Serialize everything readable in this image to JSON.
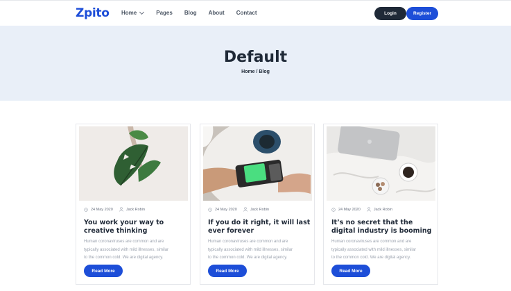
{
  "brand": {
    "logo": "Zpito",
    "accent": "#1d4ed8"
  },
  "nav": {
    "items": [
      {
        "label": "Home",
        "has_dropdown": true
      },
      {
        "label": "Pages"
      },
      {
        "label": "Blog"
      },
      {
        "label": "About"
      },
      {
        "label": "Contact"
      }
    ],
    "login": "Login",
    "register": "Register"
  },
  "hero": {
    "title": "Default",
    "breadcrumb": "Home / Blog"
  },
  "posts": [
    {
      "date": "24 May 2020",
      "author": "Jack Robin",
      "title": "You work your way to creative thinking",
      "excerpt": "Human coronaviruses are common and are typically associated with mild illnesses, similar to the common cold. We are digital agency.",
      "button": "Read More",
      "image": "hand-holding-plant-photo"
    },
    {
      "date": "24 May 2020",
      "author": "Jack Robin",
      "title": "If you do it right, it will last ever forever",
      "excerpt": "Human coronaviruses are common and are typically associated with mild illnesses, similar to the common cold. We are digital agency.",
      "button": "Read More",
      "image": "card-payment-terminal-photo"
    },
    {
      "date": "24 May 2020",
      "author": "Jack Robin",
      "title": "It’s no secret that the digital industry is booming",
      "excerpt": "Human coronaviruses are common and are typically associated with mild illnesses, similar to the common cold. We are digital agency.",
      "button": "Read More",
      "image": "laptop-coffee-on-bed-photo"
    }
  ]
}
